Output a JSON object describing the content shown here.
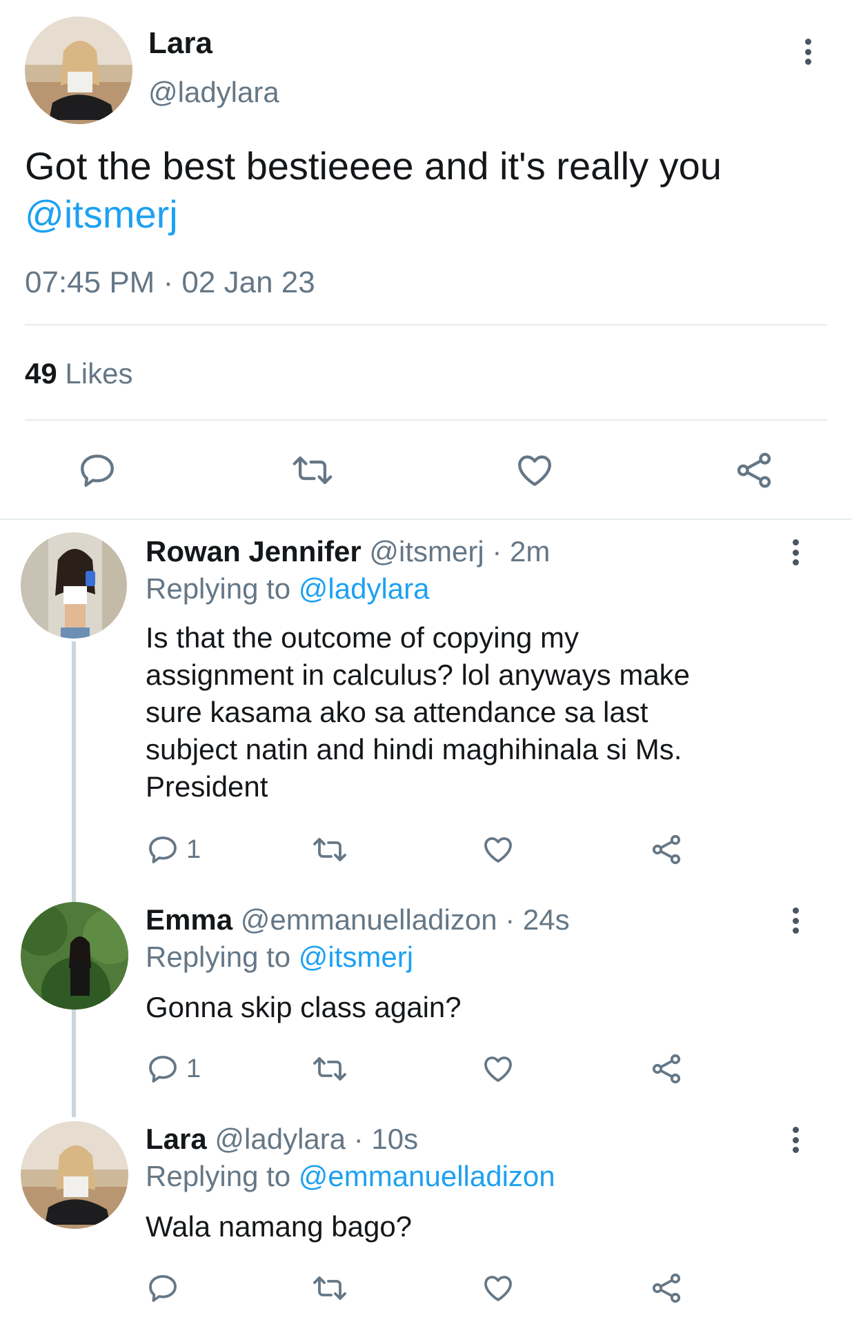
{
  "main_tweet": {
    "author_name": "Lara",
    "author_handle": "@ladylara",
    "text": "Got the best bestieeee and it's really you",
    "mention": "@itsmerj",
    "timestamp": "07:45 PM · 02 Jan 23",
    "likes_count": "49",
    "likes_label": "Likes"
  },
  "replies": [
    {
      "author_name": "Rowan Jennifer",
      "handle_time": "@itsmerj · 2m",
      "replying_label": "Replying to",
      "replying_to": "@ladylara",
      "text_lines": [
        "Is that the outcome of copying my",
        "assignment in calculus? lol anyways make",
        "sure kasama ako sa attendance sa last",
        "subject natin and hindi maghihinala si Ms.",
        "President"
      ],
      "reply_count": "1"
    },
    {
      "author_name": "Emma",
      "handle_time": "@emmanuelladizon · 24s",
      "replying_label": "Replying to",
      "replying_to": "@itsmerj",
      "text_lines": [
        "Gonna skip class again?"
      ],
      "reply_count": "1"
    },
    {
      "author_name": "Lara",
      "handle_time": "@ladylara · 10s",
      "replying_label": "Replying to",
      "replying_to": "@emmanuelladizon",
      "text_lines": [
        "Wala namang bago?"
      ],
      "reply_count": ""
    }
  ],
  "icons": [
    "more-vert-icon",
    "reply-icon",
    "retweet-icon",
    "like-icon",
    "share-icon"
  ],
  "colors": {
    "link": "#1da1f2",
    "secondary_text": "#657786",
    "icon": "#657786",
    "divider": "#e6ecf0"
  }
}
